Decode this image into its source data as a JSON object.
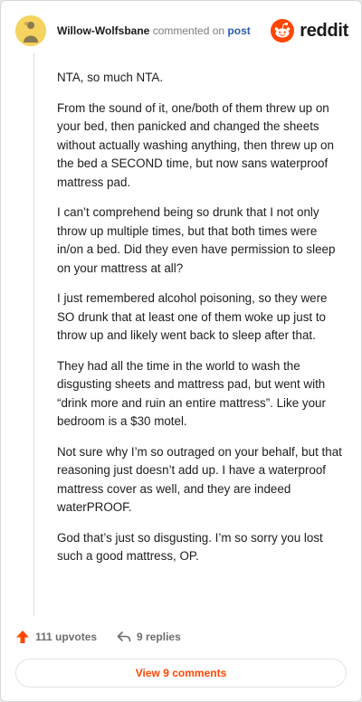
{
  "header": {
    "author": "Willow-Wolfsbane",
    "action_text": "commented on",
    "post_link": "post",
    "brand": "reddit",
    "brand_color": "#ff4500",
    "avatar_icon": "snoo-avatar-icon"
  },
  "comment": {
    "paragraphs": [
      "NTA, so much NTA.",
      "From the sound of it, one/both of them threw up on your bed, then panicked and changed the sheets without actually washing anything, then threw up on the bed a SECOND time, but now sans waterproof mattress pad.",
      "I can’t comprehend being so drunk that I not only throw up multiple times, but that both times were in/on a bed. Did they even have permission to sleep on your mattress at all?",
      "I just remembered alcohol poisoning, so they were SO drunk that at least one of them woke up just to throw up and likely went back to sleep after that.",
      "They had all the time in the world to wash the disgusting sheets and mattress pad, but went with “drink more and ruin an entire mattress”. Like your bedroom is a $30 motel.",
      "Not sure why I’m so outraged on your behalf, but that reasoning just doesn’t add up. I have a waterproof mattress cover as well, and they are indeed waterPROOF.",
      "God that’s just so disgusting. I’m so sorry you lost such a good mattress, OP."
    ]
  },
  "footer": {
    "upvotes": "111 upvotes",
    "replies": "9 replies",
    "view_comments": "View 9 comments",
    "upvote_icon": "upvote-arrow-icon",
    "reply_icon": "reply-arrow-icon"
  }
}
